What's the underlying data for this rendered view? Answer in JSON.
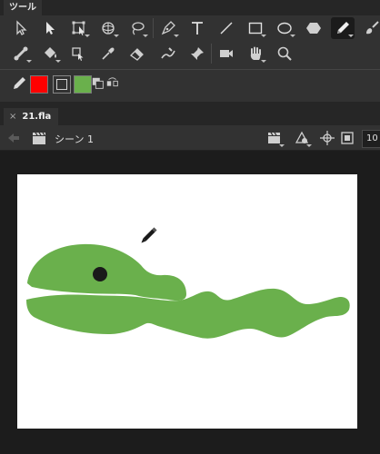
{
  "tools_panel": {
    "title": "ツール",
    "row1": [
      "selection-tool",
      "subselection-tool",
      "free-transform-tool",
      "3d-rotation-tool",
      "lasso-tool",
      "pen-tool",
      "text-tool",
      "line-tool",
      "rectangle-tool",
      "oval-tool",
      "polystar-tool",
      "pencil-tool",
      "brush-tool"
    ],
    "row2": [
      "bone-tool",
      "paint-bucket-tool",
      "asset-warp-tool",
      "eyedropper-tool",
      "eraser-tool",
      "width-tool",
      "pin-tool",
      "camera-tool",
      "hand-tool",
      "zoom-tool"
    ],
    "stroke_color": "#ff0000",
    "fill_color": "#6ab04c",
    "active_tool": "pencil-tool"
  },
  "document": {
    "tab_label": "21.fla",
    "close_glyph": "×",
    "scene_label": "シーン 1",
    "zoom_value": "10",
    "stage_color": "#ffffff",
    "pasteboard_color": "#1c1c1c"
  },
  "drawing": {
    "snake_color": "#6ab04c",
    "eye_color": "#1a1a1a"
  }
}
